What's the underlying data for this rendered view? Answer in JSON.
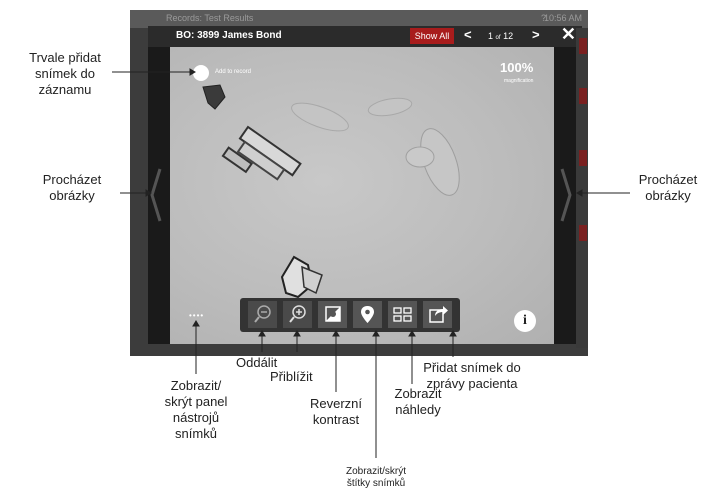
{
  "app": {
    "status_title": "Records: Test Results",
    "status_help": "?",
    "status_time": "10:56 AM",
    "patient_title": "BO: 3899 James Bond",
    "show_all_label": "Show All",
    "prev_label": "<",
    "next_label": ">",
    "page_current": "1",
    "page_of": "of",
    "page_total": "12",
    "close_label": "✕",
    "add_to_record_label": "Add to record",
    "magnification_value": "100%",
    "magnification_label": "magnification",
    "info_label": "i"
  },
  "toolbar": {
    "buttons": [
      {
        "name": "zoom-out",
        "icon": "zoom-out-icon",
        "glyph": "⊖"
      },
      {
        "name": "zoom-in",
        "icon": "zoom-in-icon",
        "glyph": "⊕"
      },
      {
        "name": "reverse-contrast",
        "icon": "contrast-icon",
        "glyph": "◧"
      },
      {
        "name": "toggle-labels",
        "icon": "location-pin-icon",
        "glyph": "●"
      },
      {
        "name": "thumbnails",
        "icon": "grid-icon",
        "glyph": "⊞"
      },
      {
        "name": "share",
        "icon": "share-icon",
        "glyph": "↪"
      }
    ]
  },
  "annotations": {
    "add_permanently": [
      "Trvale přidat",
      "snímek do",
      "záznamu"
    ],
    "browse_left": [
      "Procházet",
      "obrázky"
    ],
    "browse_right": [
      "Procházet",
      "obrázky"
    ],
    "toggle_toolbar": [
      "Zobrazit/",
      "skrýt panel",
      "nástrojů",
      "snímků"
    ],
    "zoom_out": "Oddálit",
    "zoom_in": "Přiblížit",
    "reverse_contrast": [
      "Reverzní",
      "kontrast"
    ],
    "toggle_labels": [
      "Zobrazit/skrýt",
      "štítky snímků"
    ],
    "thumbnails": [
      "Zobrazit",
      "náhledy"
    ],
    "add_to_report": [
      "Přidat snímek do",
      "zprávy pacienta"
    ]
  },
  "colors": {
    "accent_red": "#a81c1c",
    "device_dark": "#2b2b2b",
    "image_gray": "#bcbcbc"
  }
}
